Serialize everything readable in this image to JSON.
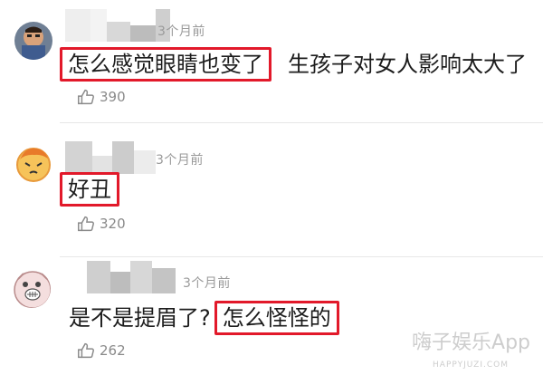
{
  "comments": [
    {
      "time": "3个月前",
      "highlight": "怎么感觉眼睛也变了",
      "rest": "生孩子对女人影响太大了",
      "likes": "390"
    },
    {
      "time": "3个月前",
      "highlight": "好丑",
      "rest": "",
      "likes": "320"
    },
    {
      "time": "3个月前",
      "prefix": "是不是提眉了?",
      "highlight": "怎么怪怪的",
      "likes": "262"
    }
  ],
  "icons": {
    "like": "thumbs-up-icon"
  },
  "colors": {
    "highlight_border": "#e2192a",
    "meta_text": "#9a9a9a",
    "divider": "#e7e7e7"
  },
  "watermark": {
    "main": "嗨子娱乐App",
    "sub": "HAPPYJUZI.COM"
  }
}
